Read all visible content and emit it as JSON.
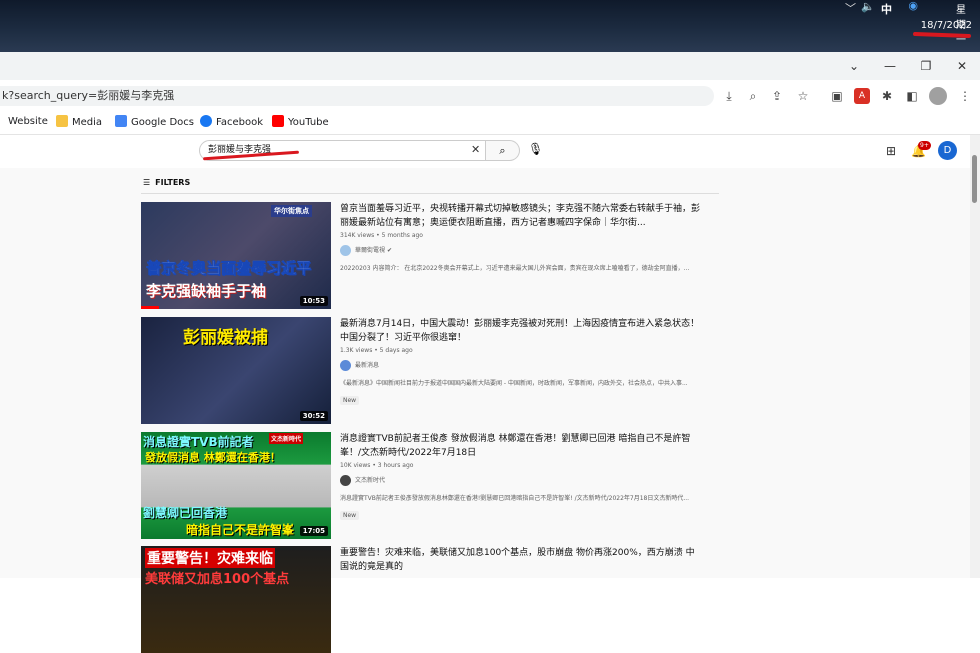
{
  "tray": {
    "ime": "中",
    "day": "星期一",
    "date": "18/7/2022"
  },
  "browser": {
    "url": "k?search_query=彭丽媛与李克强",
    "bookmarks": [
      {
        "label": "Website",
        "color": "#ffffff"
      },
      {
        "label": "Media",
        "color": "#f6c343"
      },
      {
        "label": "Google Docs",
        "color": "#4285f4"
      },
      {
        "label": "Facebook",
        "color": "#1877f2"
      },
      {
        "label": "YouTube",
        "color": "#ff0000"
      }
    ],
    "profile_initial": ""
  },
  "youtube": {
    "search_value": "彭丽媛与李克强",
    "notif_count": "9+",
    "avatar_initial": "D",
    "filters_label": "FILTERS"
  },
  "results": [
    {
      "title": "曾京当面羞辱习近平，央视转播开幕式切掉敏感镜头；李克强不随六常委右转献手于袖，彭丽媛最新站位有寓意；奥运便衣阻断直播，西方记者惠嘁四字保命｜华尔街...",
      "stats": "314K views • 5 months ago",
      "channel": "華爾街電視",
      "desc": "20220203 内容简介： 在北京2022冬奥会开幕式上，习近平遭来最大国儿外宾会面，贵宾在现众席上嗑嗑看了，德劫金阿直播，...",
      "duration": "10:53",
      "new": "",
      "thumb_tag": "华尔街焦点",
      "thumb_line1": "普京冬奥当面羞辱习近平",
      "thumb_line2": "李克强缺袖手于袖"
    },
    {
      "title": "最新消息7月14日，中国大震动！彭丽媛李克强被对死刑！上海因疫情宣布进入紧急状态！中国分裂了！习近平你很逃窜！",
      "stats": "1.3K views • 5 days ago",
      "channel": "最新消息",
      "desc": "《最新消息》中国新闻社目前力于报道中国国内最新大陆要闻 - 中国新闻，时政新闻，军事新闻，内政外交，社会热点，中共入事...",
      "duration": "30:52",
      "new": "New",
      "thumb_line1": "彭丽媛被捕"
    },
    {
      "title": "消息證實TVB前記者王俊彥 發放假消息 林鄭還在香港！劉慧卿已回港 暗指自己不是許智峯！/文杰新時代/2022年7月18日",
      "stats": "10K views • 3 hours ago",
      "channel": "文杰新时代",
      "desc": "消息證實TVB前記者王俊彥發放假消息林鄭還在香港!劉慧卿已回港暗指自己不是許智峯! /文杰新時代/2022年7月18日文杰新時代...",
      "duration": "17:05",
      "new": "New",
      "thumb_tag": "文杰新時代",
      "thumb_line1": "消息證實TVB前記者",
      "thumb_line2": "發放假消息 林鄭還在香港！",
      "thumb_line3": "劉慧卿已回香港",
      "thumb_line4": "暗指自己不是許智峯"
    },
    {
      "title": "重要警告！灾难来临，美联储又加息100个基点，股市崩盘 物价再涨200%，西方崩溃 中国说的竟是真的",
      "thumb_line1": "重要警告！灾难来临",
      "thumb_line2": "美联储又加息100个基点"
    }
  ]
}
